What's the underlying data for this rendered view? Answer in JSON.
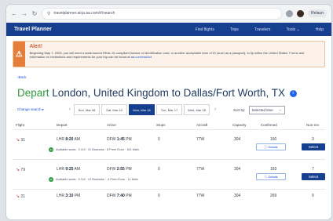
{
  "browser": {
    "url": "travelplanner.airja.aa.com/#/search",
    "relaunch_label": "Relaun"
  },
  "app": {
    "title": "Travel Planner",
    "nav": [
      "Find flights",
      "Trips",
      "Travelers",
      "Tools ⌄",
      "Help"
    ]
  },
  "alert": {
    "title": "Alert!",
    "text": "Beginning May 7, 2025, you will need a state-issued REAL ID-compliant license or identification card, or another acceptable form of ID (such as a passport), to fly within the United States. Forms and information on restrictions and requirements for your trip can be found at",
    "link": "aa.com/restrict"
  },
  "back_link": "‹Back",
  "route": {
    "depart_word": "Depart",
    "text": "London, United Kingdom to Dallas/Fort Worth, TX"
  },
  "dates": {
    "change_search": "Change search ▸",
    "items": [
      "Sun, Mar 08",
      "Sat, Mar 10",
      "Mon, Mar 16",
      "Tue, Mar 17",
      "Wed, Mar 18"
    ],
    "selected_index": 2
  },
  "sort": {
    "label": "Sort by:",
    "value": "Selected time"
  },
  "columns": [
    "Flight",
    "Depart",
    "Arrive",
    "Stops",
    "Aircraft",
    "Capacity",
    "Confirmed",
    "Non-rev"
  ],
  "flights": [
    {
      "flight": "31",
      "depart_code": "LHR",
      "depart_time": "8:20",
      "depart_ampm": "AM",
      "arrive_code": "DFW",
      "arrive_time": "1:45",
      "arrive_ampm": "PM",
      "stops": "0",
      "aircraft": "77W",
      "capacity": "304",
      "confirmed": "160",
      "nonrev": "3",
      "seats_badge": "34",
      "seats_label": "Available seats",
      "seat_detail": "3  Crit  ·  31  Business  ·  8  Prem Econ  ·  161  Main"
    },
    {
      "flight": "79",
      "depart_code": "LHR",
      "depart_time": "9:25",
      "depart_ampm": "AM",
      "arrive_code": "DFW",
      "arrive_time": "2:55",
      "arrive_ampm": "PM",
      "stops": "0",
      "aircraft": "77W",
      "capacity": "304",
      "confirmed": "183",
      "nonrev": "7",
      "seats_badge": "21",
      "seats_label": "Available seats",
      "seat_detail": "3  Crit  ·  12  Business  ·  -4  Prem Econ  ·  11  Main"
    },
    {
      "flight": "21",
      "depart_code": "LHR",
      "depart_time": "3:10",
      "depart_ampm": "PM",
      "arrive_code": "DFW",
      "arrive_time": "7:40",
      "arrive_ampm": "PM",
      "stops": "0",
      "aircraft": "77W",
      "capacity": "304",
      "confirmed": "269",
      "nonrev": "0"
    }
  ],
  "row_buttons": {
    "details": "ⓘ Details",
    "select": "Select"
  }
}
